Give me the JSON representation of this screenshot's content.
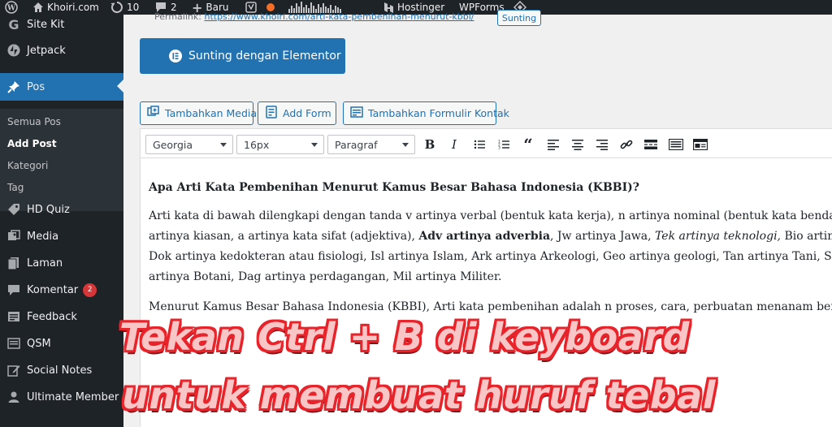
{
  "admin_bar": {
    "site_name": "Khoiri.com",
    "updates_count": "10",
    "comments_count": "2",
    "new_label": "Baru",
    "hostinger_label": "Hostinger",
    "wpforms_label": "WPForms",
    "colors": {
      "bg": "#1d2327",
      "dot": "#f56e28"
    }
  },
  "sidebar": {
    "items_top": [
      {
        "label": "Site Kit",
        "icon": "sitekit-g-icon"
      },
      {
        "label": "Jetpack",
        "icon": "jetpack-icon"
      },
      {
        "label": "Pos",
        "icon": "pin-icon",
        "active": true
      }
    ],
    "submenu": [
      {
        "label": "Semua Pos"
      },
      {
        "label": "Add Post",
        "current": true
      },
      {
        "label": "Kategori"
      },
      {
        "label": "Tag"
      }
    ],
    "items_bottom": [
      {
        "label": "HD Quiz",
        "icon": "tag-icon"
      },
      {
        "label": "Media",
        "icon": "media-icon"
      },
      {
        "label": "Laman",
        "icon": "page-icon"
      },
      {
        "label": "Komentar",
        "icon": "comment-icon",
        "badge": "2"
      },
      {
        "label": "Feedback",
        "icon": "feedback-icon"
      },
      {
        "label": "QSM",
        "icon": "qsm-icon"
      },
      {
        "label": "Social Notes",
        "icon": "edit-icon"
      },
      {
        "label": "Ultimate Member",
        "icon": "user-icon"
      }
    ],
    "colors": {
      "bg": "#1d2327",
      "active": "#2271b1"
    }
  },
  "permalink": {
    "label": "Permalink:",
    "url": "https://www.khoiri.com/arti-kata-pembenihan-menurut-kbbi/",
    "edit_label": "Sunting"
  },
  "elementor_button": {
    "label": "Sunting dengan Elementor"
  },
  "media_buttons": [
    {
      "label": "Tambahkan Media",
      "icon": "add-media-icon"
    },
    {
      "label": "Add Form",
      "icon": "form-icon"
    },
    {
      "label": "Tambahkan Formulir Kontak",
      "icon": "contact-form-icon"
    }
  ],
  "toolbar": {
    "font_family": "Georgia",
    "font_size": "16px",
    "format": "Paragraf",
    "buttons": [
      "bold-icon",
      "italic-icon",
      "bullet-list-icon",
      "numbered-list-icon",
      "blockquote-icon",
      "align-left-icon",
      "align-center-icon",
      "align-right-icon",
      "link-icon",
      "more-tag-icon",
      "keyboard-icon",
      "toolbar-toggle-icon"
    ]
  },
  "content": {
    "heading": "Apa Arti Kata Pembenihan Menurut Kamus Besar Bahasa Indonesia (KBBI)?",
    "p1": {
      "line1": "Arti kata di bawah dilengkapi dengan tanda v artinya verbal (bentuk kata kerja), n artinya nominal (bentuk kata benda), pb a",
      "line2_a": "artinya kiasan, a artinya kata sifat (adjektiva), ",
      "line2_bold": "Adv artinya adverbia",
      "line2_b": ", Jw artinya Jawa, ",
      "line2_italic": "Tek artinya teknologi,",
      "line2_c": " Bio artinya B",
      "line3": "Dok artinya kedokteran atau fisiologi, Isl artinya Islam, Ark artinya Arkeologi, Geo artinya geologi, Tan artinya Tani, Stat art",
      "line4": "artinya Botani, Dag artinya perdagangan, Mil artinya Militer."
    },
    "p2": "Menurut Kamus Besar Bahasa Indonesia (KBBI), Arti kata pembenihan adalah n proses, cara, perbuatan menanam benih."
  },
  "overlay": {
    "line1": "Tekan Ctrl + B di keyboard",
    "line2": "untuk membuat huruf tebal",
    "colors": {
      "fill": "#f8c6c6",
      "stroke": "#e8232a"
    }
  }
}
